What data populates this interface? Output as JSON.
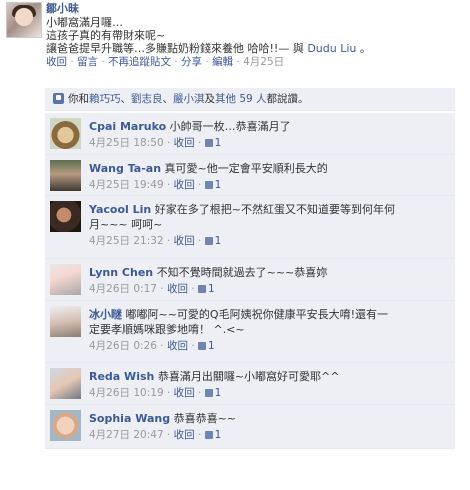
{
  "post": {
    "author": "鄒小昧",
    "lines": [
      "小嘟窩滿月囉…",
      "這孩子真的有帶財來呢~",
      "讓爸爸提早升職等…多賺點奶粉錢來養他 哈哈!!—"
    ],
    "with_prefix": "與",
    "with_name": "Dudu Liu",
    "with_suffix": "。",
    "actions": [
      "收回",
      "留言",
      "不再追蹤貼文",
      "分享",
      "編輯"
    ],
    "date": "4月25日"
  },
  "likes": {
    "prefix": "你和",
    "names": [
      "賴巧巧",
      "劉志良",
      "嚴小淇"
    ],
    "sep": "、",
    "and_word": "及",
    "others": "其他 59 人",
    "suffix": "都說讚。"
  },
  "comments": [
    {
      "author": "Cpai Maruko",
      "text": "小帥哥一枚…恭喜滿月了",
      "time": "4月25日 18:50",
      "undo": "收回",
      "likes": "1"
    },
    {
      "author": "Wang Ta-an",
      "text": "真可愛~他一定會平安順利長大的",
      "time": "4月25日 19:49",
      "undo": "收回",
      "likes": "1"
    },
    {
      "author": "Yacool Lin",
      "text": "好家在多了根把~不然紅蛋又不知道要等到何年何",
      "text2": "月~~~   呵呵~",
      "time": "4月25日 21:32",
      "undo": "收回",
      "likes": "1"
    },
    {
      "author": "Lynn Chen",
      "text": "不知不覺時間就過去了~~~恭喜妳",
      "time": "4月26日 0:17",
      "undo": "收回",
      "likes": "1"
    },
    {
      "author": "冰小瞇",
      "text": "嘟嘟阿~~可愛的Q毛阿姨祝你健康平安長大唷!還有一",
      "text2": "定要孝順媽咪跟爹地唷！ ^.<~",
      "time": "4月26日 0:26",
      "undo": "收回",
      "likes": "1"
    },
    {
      "author": "Reda Wish",
      "text": "恭喜滿月出關囉~小嘟窩好可愛耶^^",
      "time": "4月26日 10:19",
      "undo": "收回",
      "likes": "1"
    },
    {
      "author": "Sophia Wang",
      "text": "恭喜恭喜~~",
      "time": "4月27日 20:47",
      "undo": "收回",
      "likes": "1"
    }
  ],
  "colors": {
    "link": "#3b5998",
    "comment_bg": "#edeff4",
    "meta": "#999999"
  }
}
